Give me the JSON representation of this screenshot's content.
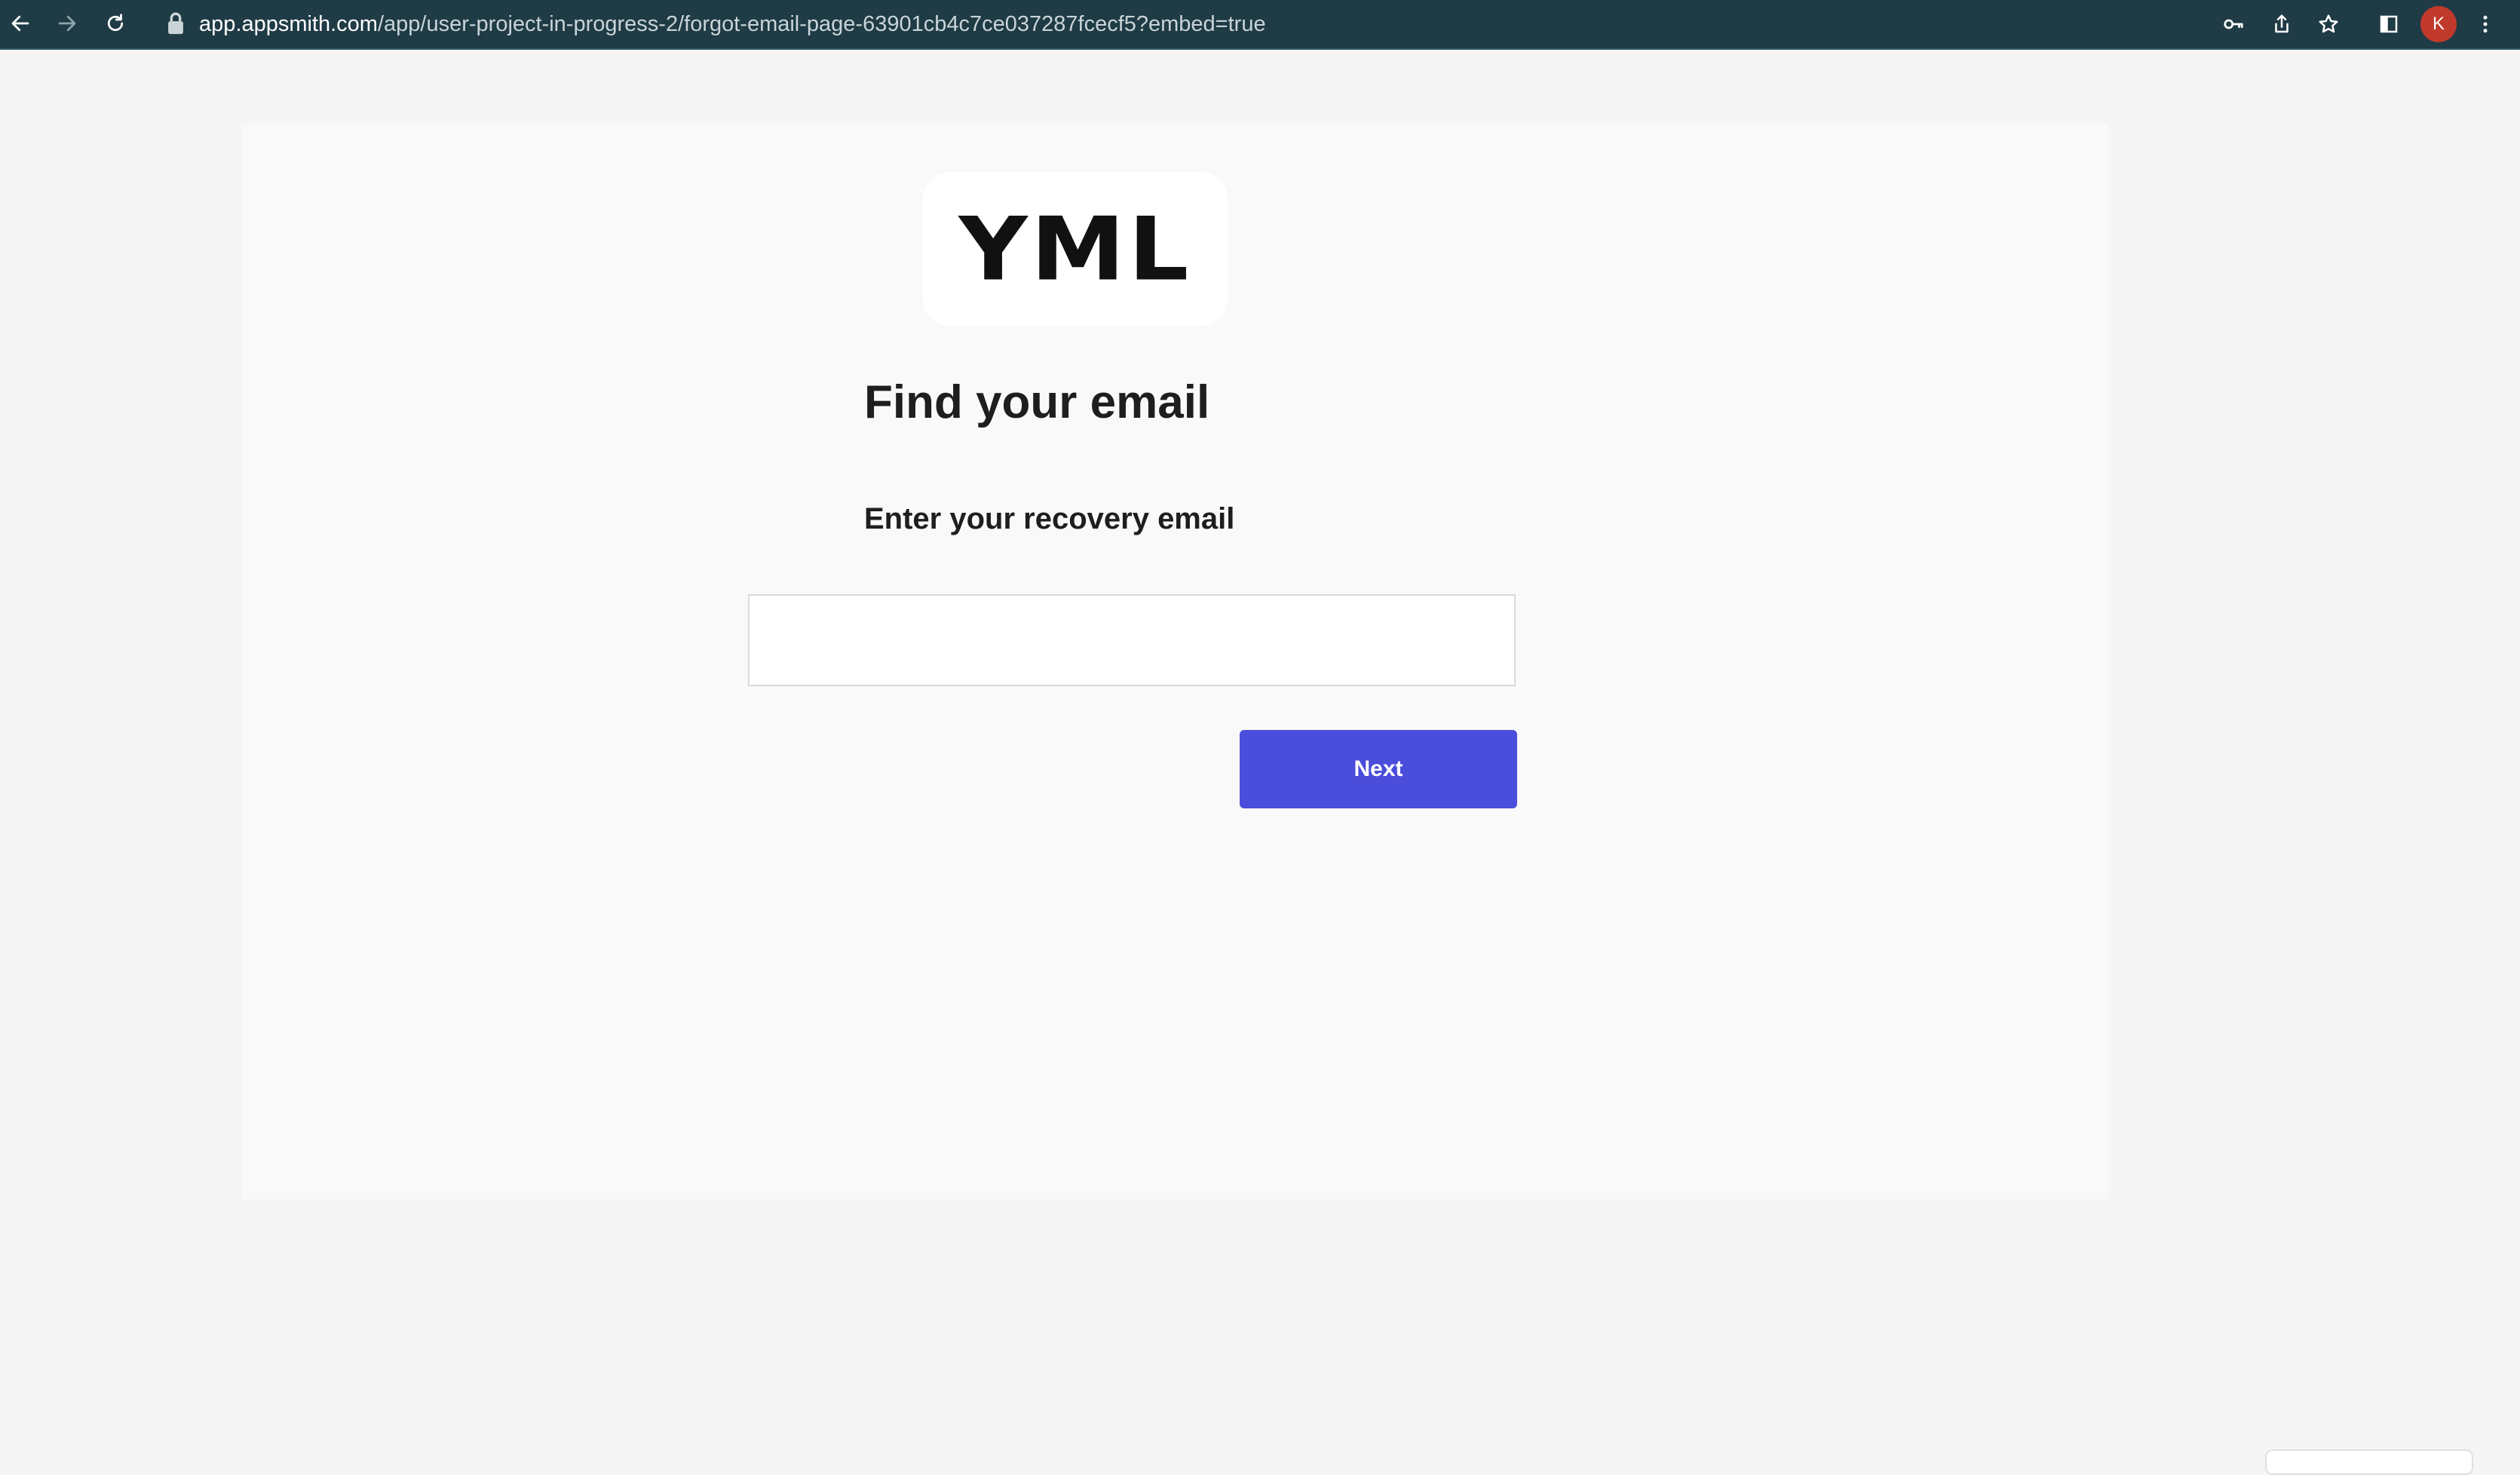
{
  "browser": {
    "url_host": "app.appsmith.com",
    "url_path": "/app/user-project-in-progress-2/forgot-email-page-63901cb4c7ce037287fcecf5?embed=true",
    "profile_initial": "K",
    "icons": [
      "back-arrow-icon",
      "forward-arrow-icon",
      "reload-icon",
      "lock-icon",
      "key-icon",
      "share-icon",
      "star-icon",
      "sidebar-icon",
      "more-vertical-icon"
    ]
  },
  "page": {
    "logo_text": "YML",
    "title": "Find your email",
    "prompt_label": "Enter your recovery email",
    "email_input": {
      "value": "",
      "placeholder": ""
    },
    "next_button_label": "Next"
  },
  "colors": {
    "browser_bar": "#1f3b45",
    "primary_button": "#4b4ddb",
    "avatar": "#c0392b",
    "page_background": "#f5f5f5",
    "card_background": "#f9f9f9"
  }
}
